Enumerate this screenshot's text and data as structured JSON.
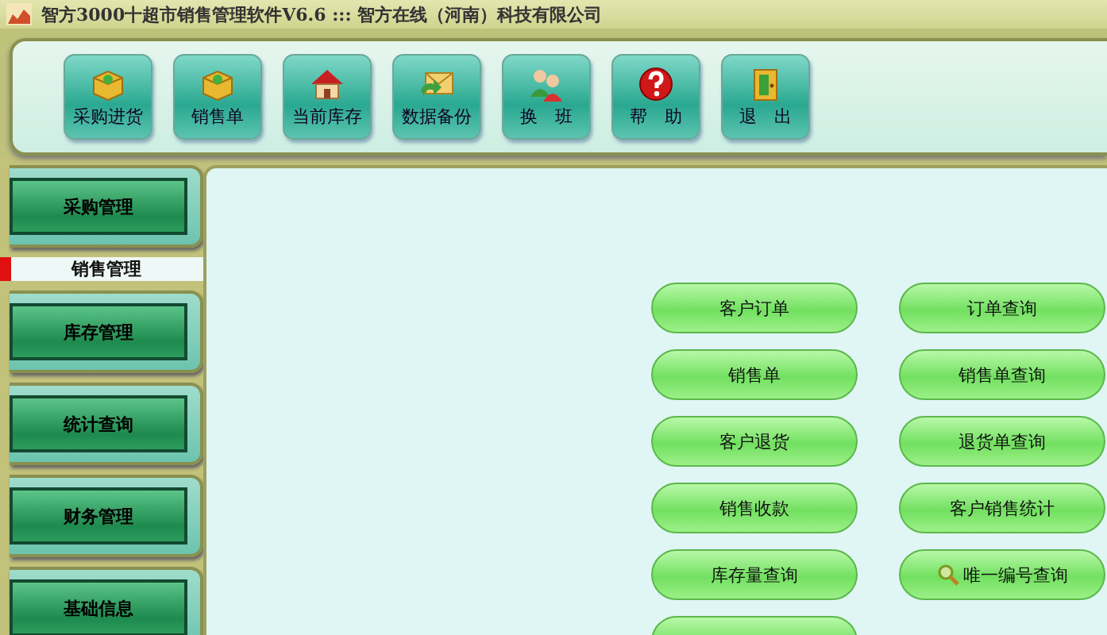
{
  "window": {
    "title": "智方3000十超市销售管理软件V6.6 ::: 智方在线（河南）科技有限公司"
  },
  "toolbar": [
    {
      "label": "采购进货"
    },
    {
      "label": "销售单"
    },
    {
      "label": "当前库存"
    },
    {
      "label": "数据备份"
    },
    {
      "label": "换　班"
    },
    {
      "label": "帮　助"
    },
    {
      "label": "退　出"
    }
  ],
  "sidebar": {
    "items": [
      {
        "label": "采购管理",
        "selected": false
      },
      {
        "label": "销售管理",
        "selected": true
      },
      {
        "label": "库存管理",
        "selected": false
      },
      {
        "label": "统计查询",
        "selected": false
      },
      {
        "label": "财务管理",
        "selected": false
      },
      {
        "label": "基础信息",
        "selected": false
      }
    ]
  },
  "actions": [
    {
      "label": "客户订单",
      "kind": "plain"
    },
    {
      "label": "订单查询",
      "kind": "plain"
    },
    {
      "label": "销售单",
      "kind": "plain"
    },
    {
      "label": "销售单查询",
      "kind": "plain"
    },
    {
      "label": "客户退货",
      "kind": "plain"
    },
    {
      "label": "退货单查询",
      "kind": "plain"
    },
    {
      "label": "销售收款",
      "kind": "plain"
    },
    {
      "label": "客户销售统计",
      "kind": "plain"
    },
    {
      "label": "库存量查询",
      "kind": "plain"
    },
    {
      "label": "唯一编号查询",
      "kind": "search"
    },
    {
      "kind": "plain"
    }
  ]
}
